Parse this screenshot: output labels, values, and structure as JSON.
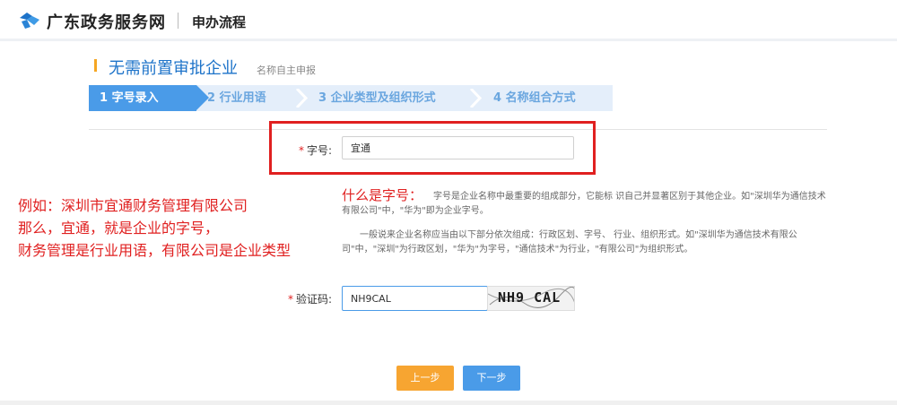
{
  "header": {
    "site_name": "广东政务服务网",
    "title": "申办流程",
    "logo_icon": "guangdong-logo-icon"
  },
  "section": {
    "title": "无需前置审批企业",
    "subtitle": "名称自主申报"
  },
  "steps": [
    {
      "label": "1 字号录入",
      "active": true
    },
    {
      "label": "2 行业用语",
      "active": false
    },
    {
      "label": "3 企业类型及组织形式",
      "active": false
    },
    {
      "label": "4 名称组合方式",
      "active": false
    }
  ],
  "form": {
    "name_field": {
      "required_mark": "*",
      "label": "字号:",
      "value": "宜通"
    },
    "captcha_field": {
      "required_mark": "*",
      "label": "验证码:",
      "value": "NH9CAL",
      "image_text": "NH9 CAL"
    }
  },
  "annotation": {
    "line1": "例如：深圳市宜通财务管理有限公司",
    "line2": "那么，宜通，就是企业的字号，",
    "line3": "财务管理是行业用语，有限公司是企业类型",
    "what_title": "什么是字号：",
    "color": "#e02020"
  },
  "info": {
    "p1": "字号是企业名称中最重要的组成部分，它能标 识自己并显著区别于其他企业。如\"深圳华为通信技术有限公司\"中，\"华为\"即为企业字号。",
    "p2": "一般说来企业名称应当由以下部分依次组成：行政区划、字号、 行业、组织形式。如\"深圳华为通信技术有限公司\"中，\"深圳\"为行政区划，\"华为\"为字号，\"通信技术\"为行业，\"有限公司\"为组织形式。"
  },
  "buttons": {
    "prev": "上一步",
    "next": "下一步"
  },
  "colors": {
    "primary": "#4a9be8",
    "accent": "#f7a531",
    "title_blue": "#1d73c9"
  }
}
